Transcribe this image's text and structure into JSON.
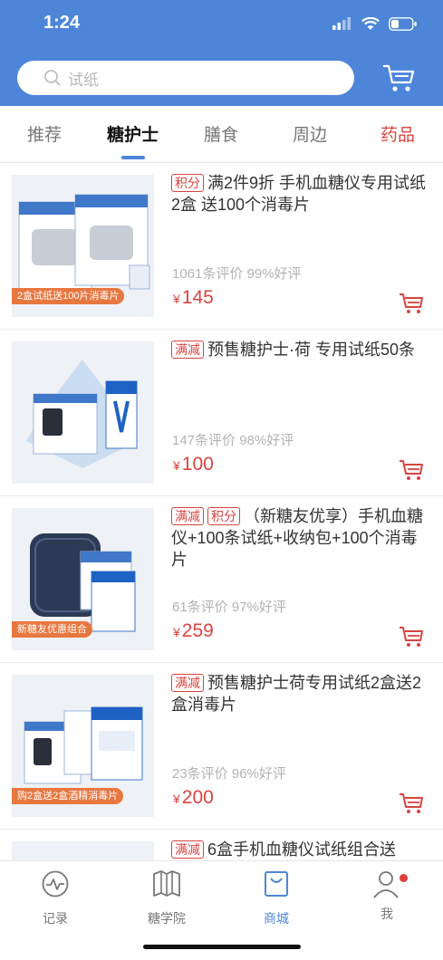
{
  "status": {
    "time": "1:24"
  },
  "search": {
    "placeholder": "试纸"
  },
  "icons": {
    "search": "search-icon",
    "cart": "cart-icon",
    "signal": "signal-icon",
    "wifi": "wifi-icon",
    "battery": "battery-icon"
  },
  "tabs": [
    {
      "label": "推荐"
    },
    {
      "label": "糖护士"
    },
    {
      "label": "膳食"
    },
    {
      "label": "周边"
    },
    {
      "label": "药品"
    }
  ],
  "products": [
    {
      "tags": [
        "积分"
      ],
      "title": "满2件9折 手机血糖仪专用试纸2盒 送100个消毒片",
      "reviews": "1061条评价 99%好评",
      "currency": "¥",
      "price": "145",
      "badge": "2盒试纸送100片消毒片"
    },
    {
      "tags": [
        "满减"
      ],
      "title": "预售糖护士·荷 专用试纸50条",
      "reviews": "147条评价 98%好评",
      "currency": "¥",
      "price": "100",
      "badge": ""
    },
    {
      "tags": [
        "满减",
        "积分"
      ],
      "title": "（新糖友优享）手机血糖仪+100条试纸+收纳包+100个消毒片",
      "reviews": "61条评价 97%好评",
      "currency": "¥",
      "price": "259",
      "badge": "新糖友优惠组合"
    },
    {
      "tags": [
        "满减"
      ],
      "title": "预售糖护士荷专用试纸2盒送2盒消毒片",
      "reviews": "23条评价 96%好评",
      "currency": "¥",
      "price": "200",
      "badge": "购2盒送2盒酒精消毒片"
    },
    {
      "tags": [
        "满减"
      ],
      "title": "6盒手机血糖仪试纸组合送",
      "reviews": "",
      "currency": "",
      "price": "",
      "badge": ""
    }
  ],
  "tabbar": [
    {
      "label": "记录",
      "icon": "record-icon"
    },
    {
      "label": "糖学院",
      "icon": "book-icon"
    },
    {
      "label": "商城",
      "icon": "shop-bag-icon"
    },
    {
      "label": "我",
      "icon": "profile-icon"
    }
  ],
  "colors": {
    "brand": "#4d86d9",
    "price": "#d8443f",
    "badge": "#e8773f"
  }
}
